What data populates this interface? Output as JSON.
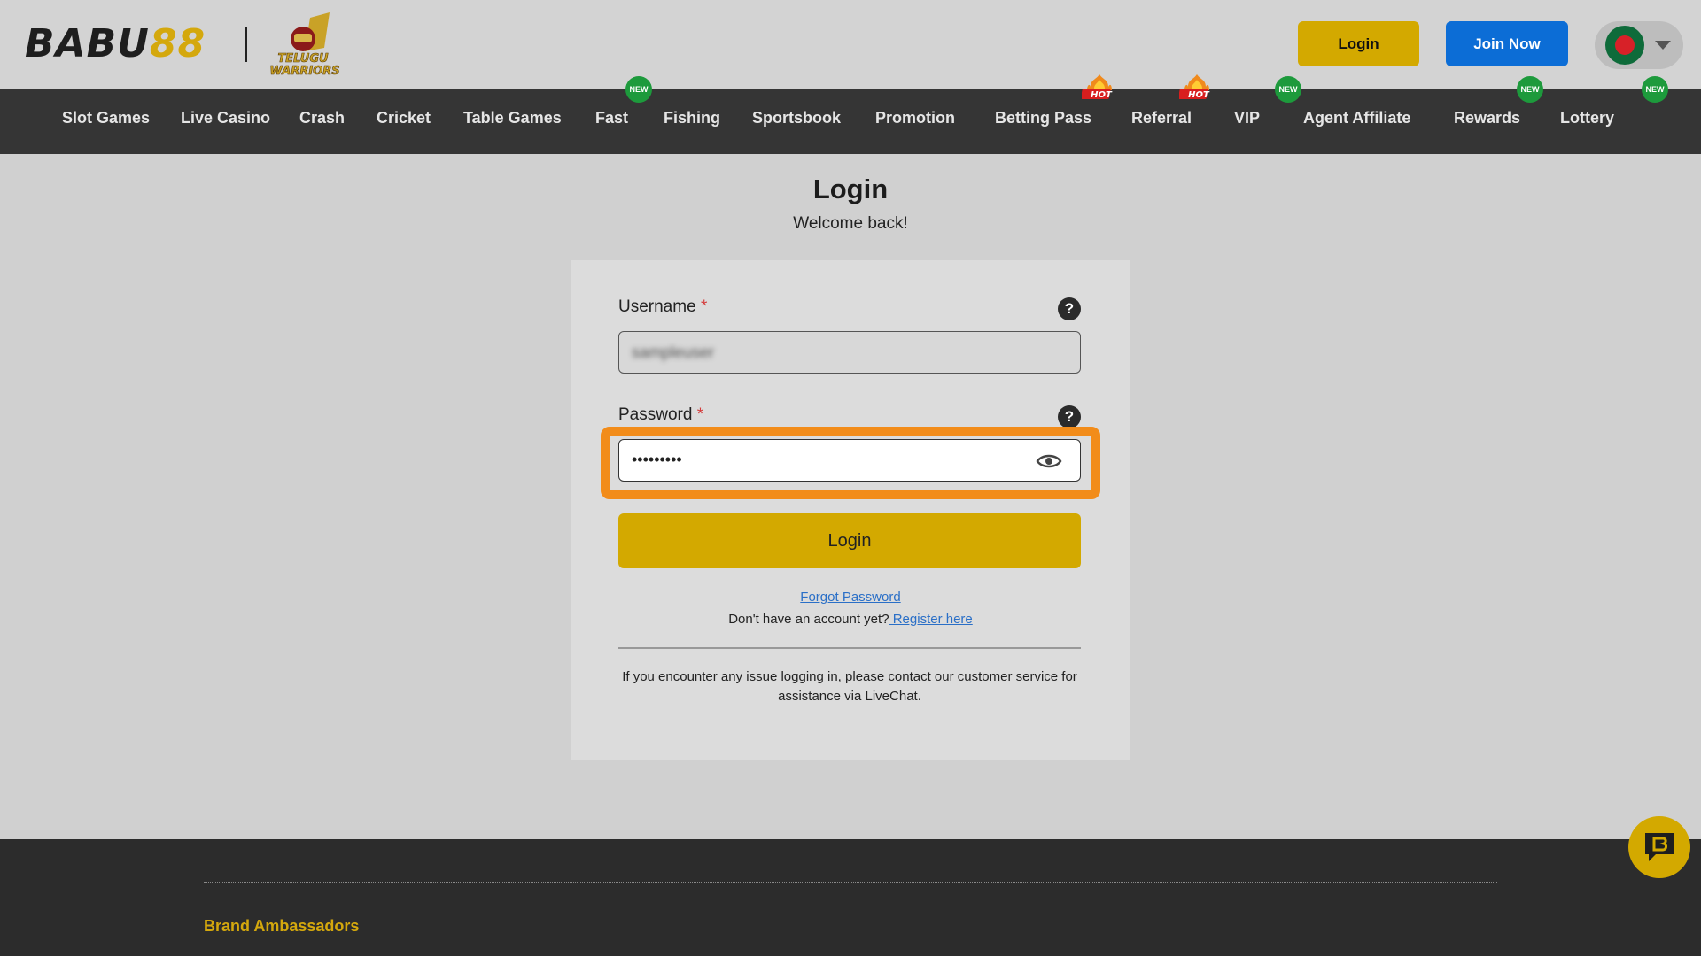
{
  "header": {
    "logo_part1": "BABU",
    "logo_part2": "88",
    "partner_logo_text": "TELUGU WARRIORS",
    "login_label": "Login",
    "join_label": "Join Now",
    "language_flag": "bangladesh-flag"
  },
  "nav": {
    "items": [
      {
        "label": "Slot Games",
        "badge": ""
      },
      {
        "label": "Live Casino",
        "badge": ""
      },
      {
        "label": "Crash",
        "badge": ""
      },
      {
        "label": "Cricket",
        "badge": ""
      },
      {
        "label": "Table Games",
        "badge": ""
      },
      {
        "label": "Fast",
        "badge": "NEW"
      },
      {
        "label": "Fishing",
        "badge": ""
      },
      {
        "label": "Sportsbook",
        "badge": ""
      },
      {
        "label": "Promotion",
        "badge": ""
      },
      {
        "label": "Betting Pass",
        "badge": "HOT"
      },
      {
        "label": "Referral",
        "badge": "HOT"
      },
      {
        "label": "VIP",
        "badge": "NEW"
      },
      {
        "label": "Agent Affiliate",
        "badge": ""
      },
      {
        "label": "Rewards",
        "badge": "NEW"
      },
      {
        "label": "Lottery",
        "badge": "NEW"
      }
    ]
  },
  "main": {
    "title": "Login",
    "subtitle": "Welcome back!",
    "username": {
      "label": "Username",
      "required_mark": "*",
      "value": "sampleuser",
      "help_icon": "?"
    },
    "password": {
      "label": "Password",
      "required_mark": "*",
      "value": "•••••••••",
      "help_icon": "?"
    },
    "login_button": "Login",
    "forgot_password": "Forgot Password",
    "no_account_text": "Don't have an account yet?",
    "register_link": " Register here",
    "info_text": "If you encounter any issue logging in, please contact our customer service for assistance via LiveChat."
  },
  "footer": {
    "brand_ambassadors": "Brand Ambassadors"
  },
  "colors": {
    "accent_gold": "#d3a900",
    "join_blue": "#0c6dd6",
    "nav_bg": "#353535",
    "highlight_orange": "#f28c1a",
    "badge_new_green": "#1d9a3c"
  }
}
